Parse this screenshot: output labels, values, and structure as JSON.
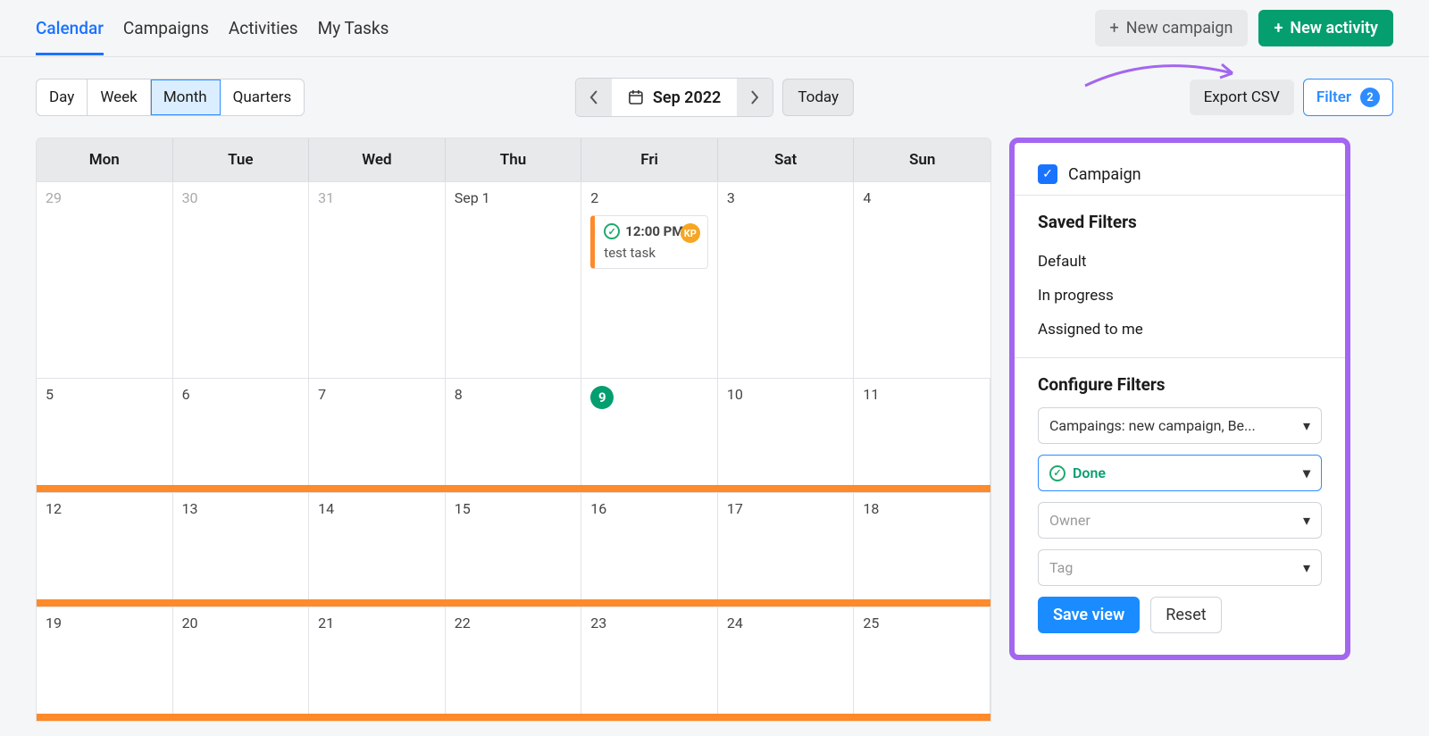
{
  "nav": {
    "tabs": [
      "Calendar",
      "Campaigns",
      "Activities",
      "My Tasks"
    ],
    "active_index": 0
  },
  "actions": {
    "new_campaign": "New campaign",
    "new_activity": "New activity"
  },
  "view": {
    "options": [
      "Day",
      "Week",
      "Month",
      "Quarters"
    ],
    "active_index": 2
  },
  "date_nav": {
    "label": "Sep 2022",
    "today": "Today"
  },
  "export_label": "Export CSV",
  "filter": {
    "label": "Filter",
    "count": "2"
  },
  "calendar": {
    "day_headers": [
      "Mon",
      "Tue",
      "Wed",
      "Thu",
      "Fri",
      "Sat",
      "Sun"
    ],
    "weeks": [
      {
        "cells": [
          "29",
          "30",
          "31",
          "Sep 1",
          "2",
          "3",
          "4"
        ],
        "other_month": [
          0,
          1,
          2
        ],
        "bar": false
      },
      {
        "cells": [
          "5",
          "6",
          "7",
          "8",
          "9",
          "10",
          "11"
        ],
        "today_index": 4,
        "bar": true
      },
      {
        "cells": [
          "12",
          "13",
          "14",
          "15",
          "16",
          "17",
          "18"
        ],
        "bar": true
      },
      {
        "cells": [
          "19",
          "20",
          "21",
          "22",
          "23",
          "24",
          "25"
        ],
        "bar": true
      }
    ],
    "event": {
      "week": 0,
      "col": 4,
      "time": "12:00 PM",
      "title": "test task",
      "badge": "KP"
    }
  },
  "panel": {
    "campaign_check": "Campaign",
    "saved_header": "Saved Filters",
    "saved": [
      "Default",
      "In progress",
      "Assigned to me"
    ],
    "configure_header": "Configure Filters",
    "campaigns_sel": "Campaings: new campaign, Be...",
    "status_sel": "Done",
    "owner_sel": "Owner",
    "tag_sel": "Tag",
    "save_view": "Save view",
    "reset": "Reset"
  }
}
